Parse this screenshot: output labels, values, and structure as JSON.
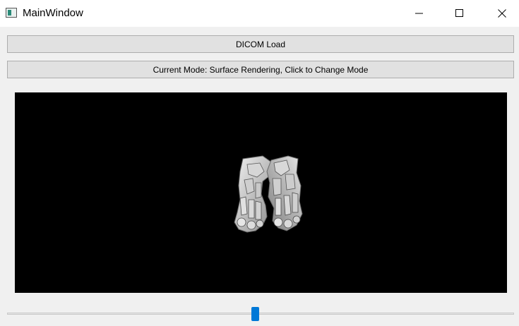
{
  "window": {
    "title": "MainWindow",
    "controls": {
      "minimize_icon": "minimize-icon",
      "maximize_icon": "maximize-icon",
      "close_icon": "close-icon"
    }
  },
  "toolbar": {
    "dicom_load_label": "DICOM Load",
    "mode_label": "Current Mode: Surface Rendering, Click to Change Mode"
  },
  "render_view": {
    "background": "#000000",
    "content": "surface-rendered-feet-bones"
  },
  "slider": {
    "value_fraction": 0.49,
    "accent": "#0078d7"
  }
}
